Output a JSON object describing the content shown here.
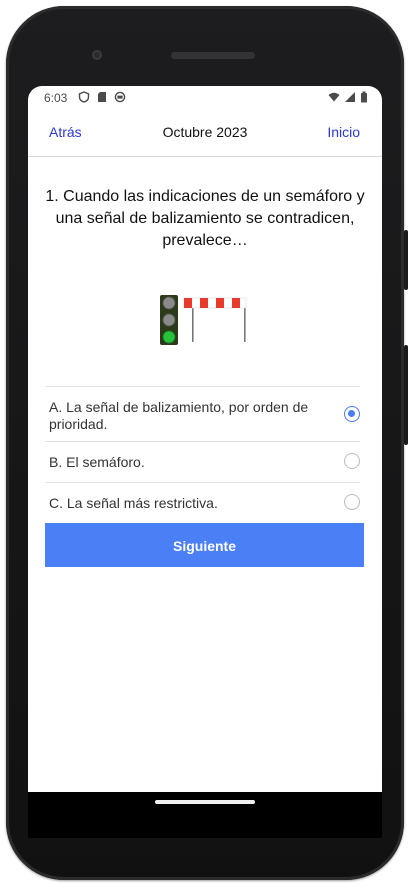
{
  "status": {
    "time": "6:03",
    "left_icons": [
      "shield-icon",
      "sd-card-icon",
      "notification-icon"
    ],
    "right_icons": [
      "wifi-icon",
      "signal-icon",
      "battery-icon"
    ]
  },
  "nav": {
    "back": "Atrás",
    "title": "Octubre 2023",
    "home": "Inicio"
  },
  "question": "1. Cuando las indicaciones de un semáforo y una señal de balizamiento se contradicen, prevalece…",
  "illustration": {
    "icons": [
      "traffic-light-icon",
      "barrier-icon"
    ],
    "colors": {
      "light_off": "#8a8a8a",
      "light_green": "#27c43b",
      "housing": "#2c3a1a",
      "stripe_red": "#e8392d"
    }
  },
  "options": [
    {
      "label": "A. La señal de balizamiento, por orden de prioridad.",
      "selected": true
    },
    {
      "label": "B. El semáforo.",
      "selected": false
    },
    {
      "label": "C. La señal más restrictiva.",
      "selected": false
    }
  ],
  "next_button": "Siguiente",
  "colors": {
    "accent": "#4b7ff5",
    "link": "#2a38d8"
  }
}
